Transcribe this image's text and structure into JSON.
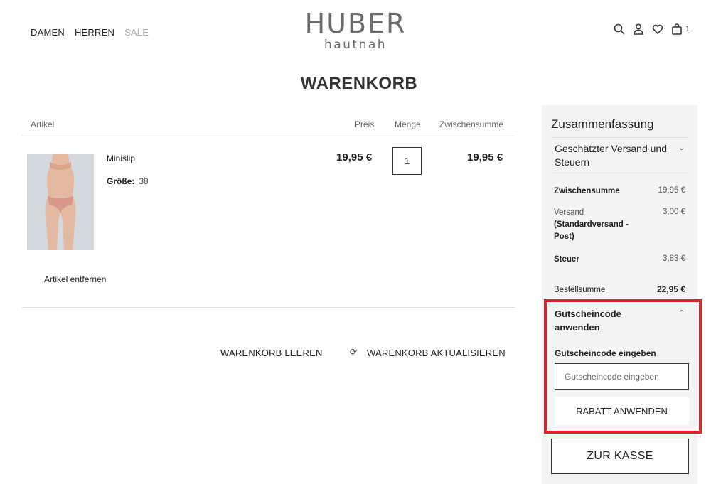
{
  "nav": {
    "items": [
      {
        "label": "DAMEN"
      },
      {
        "label": "HERREN"
      },
      {
        "label": "SALE"
      }
    ]
  },
  "logo": {
    "main": "HUBER",
    "sub": "hautnah"
  },
  "header_icons": {
    "search": "search-icon",
    "account": "user-icon",
    "wishlist": "heart-icon",
    "cart": "bag-icon",
    "cart_count": "1"
  },
  "page_title": "WARENKORB",
  "table": {
    "headers": {
      "item": "Artikel",
      "price": "Preis",
      "qty": "Menge",
      "subtotal": "Zwischensumme"
    },
    "rows": [
      {
        "name": "Minislip",
        "size_label": "Größe:",
        "size_value": "38",
        "price": "19,95 €",
        "qty": "1",
        "subtotal": "19,95 €",
        "remove_label": "Artikel entfernen"
      }
    ]
  },
  "actions": {
    "clear": "WARENKORB LEEREN",
    "update": "WARENKORB AKTUALISIEREN"
  },
  "summary": {
    "title": "Zusammenfassung",
    "shipping_toggle": "Geschätzter Versand und Steuern",
    "subtotal_label": "Zwischensumme",
    "subtotal_value": "19,95 €",
    "shipping_label": "Versand",
    "shipping_method": "(Standardversand - Post)",
    "shipping_value": "3,00 €",
    "tax_label": "Steuer",
    "tax_value": "3,83 €",
    "total_label": "Bestellsumme",
    "total_value": "22,95 €"
  },
  "coupon": {
    "title": "Gutscheincode anwenden",
    "field_label": "Gutscheincode eingeben",
    "placeholder": "Gutscheincode eingeben",
    "apply_label": "RABATT ANWENDEN"
  },
  "checkout_label": "ZUR KASSE",
  "colors": {
    "highlight": "#e0232a",
    "sidebar_bg": "#f4f4f4",
    "sale": "#aaaaaa"
  }
}
